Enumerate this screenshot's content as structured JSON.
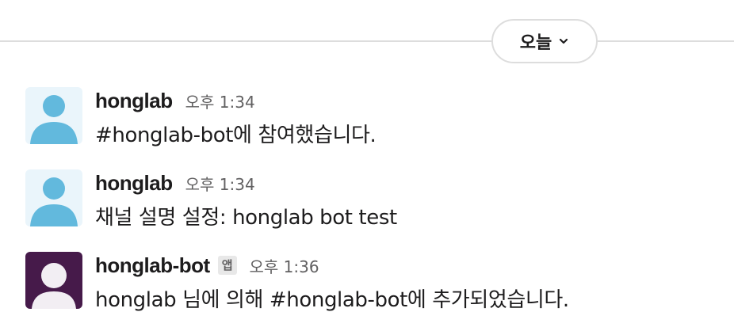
{
  "date_divider": {
    "label": "오늘",
    "icon": "chevron-down-icon"
  },
  "messages": [
    {
      "sender": "honglab",
      "is_app": false,
      "time": "오후 1:34",
      "text": "#honglab-bot에 참여했습니다.",
      "avatar_icon": "user-avatar-icon"
    },
    {
      "sender": "honglab",
      "is_app": false,
      "time": "오후 1:34",
      "text": "채널 설명 설정: honglab bot test",
      "avatar_icon": "user-avatar-icon"
    },
    {
      "sender": "honglab-bot",
      "is_app": true,
      "app_badge": "앱",
      "time": "오후 1:36",
      "text": "honglab 님에 의해 #honglab-bot에 추가되었습니다.",
      "avatar_icon": "bot-avatar-icon"
    }
  ],
  "colors": {
    "user_avatar_bg": "#eaf5fb",
    "user_avatar_fg": "#62b9dd",
    "bot_avatar_bg": "#461a4a",
    "bot_avatar_fg": "#f2eef3"
  }
}
